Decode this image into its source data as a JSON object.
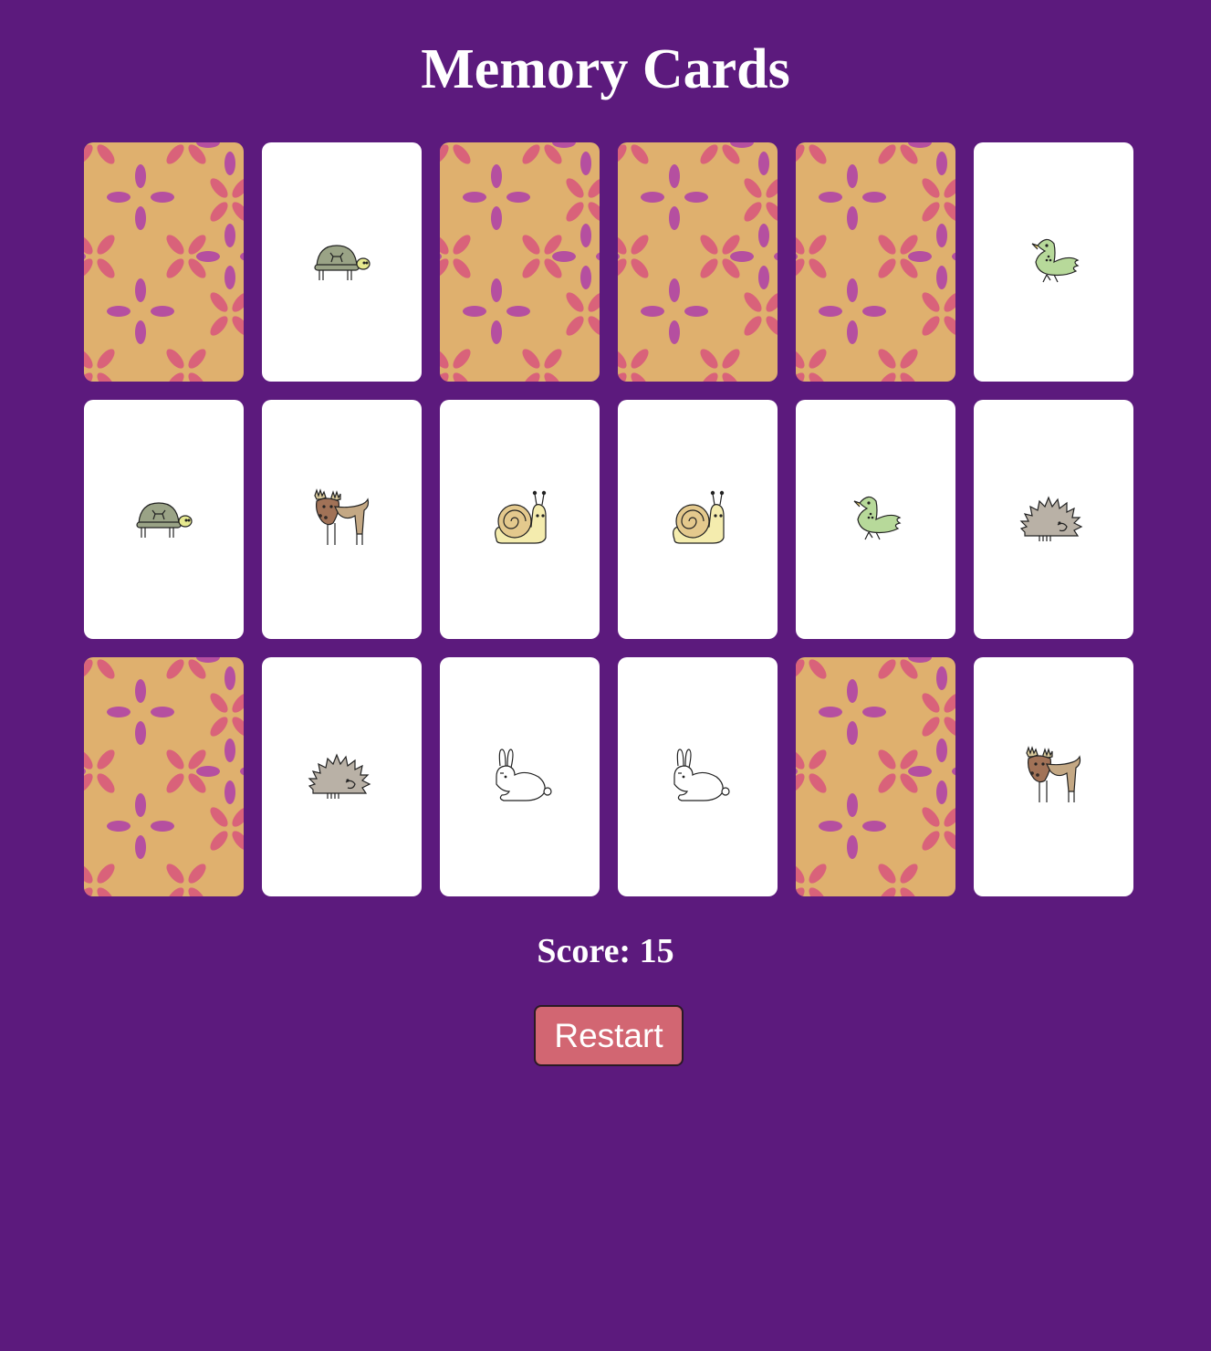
{
  "title": "Memory Cards",
  "score": {
    "label": "Score:",
    "value": "15",
    "text": "Score: 15"
  },
  "restart_label": "Restart",
  "colors": {
    "background": "#5c1a7d",
    "card_back": "#dfb06e",
    "petal_pink": "#d9627a",
    "petal_magenta": "#b54fa0",
    "card_face": "#ffffff",
    "button": "#d26672"
  },
  "cards": [
    {
      "state": "face-down",
      "animal": ""
    },
    {
      "state": "face-up",
      "animal": "turtle"
    },
    {
      "state": "face-down",
      "animal": ""
    },
    {
      "state": "face-down",
      "animal": ""
    },
    {
      "state": "face-down",
      "animal": ""
    },
    {
      "state": "face-up",
      "animal": "bird"
    },
    {
      "state": "face-up",
      "animal": "turtle"
    },
    {
      "state": "face-up",
      "animal": "moose"
    },
    {
      "state": "face-up",
      "animal": "snail"
    },
    {
      "state": "face-up",
      "animal": "snail"
    },
    {
      "state": "face-up",
      "animal": "bird"
    },
    {
      "state": "face-up",
      "animal": "hedgehog"
    },
    {
      "state": "face-down",
      "animal": ""
    },
    {
      "state": "face-up",
      "animal": "hedgehog"
    },
    {
      "state": "face-up",
      "animal": "rabbit"
    },
    {
      "state": "face-up",
      "animal": "rabbit"
    },
    {
      "state": "face-down",
      "animal": ""
    },
    {
      "state": "face-up",
      "animal": "moose"
    }
  ]
}
